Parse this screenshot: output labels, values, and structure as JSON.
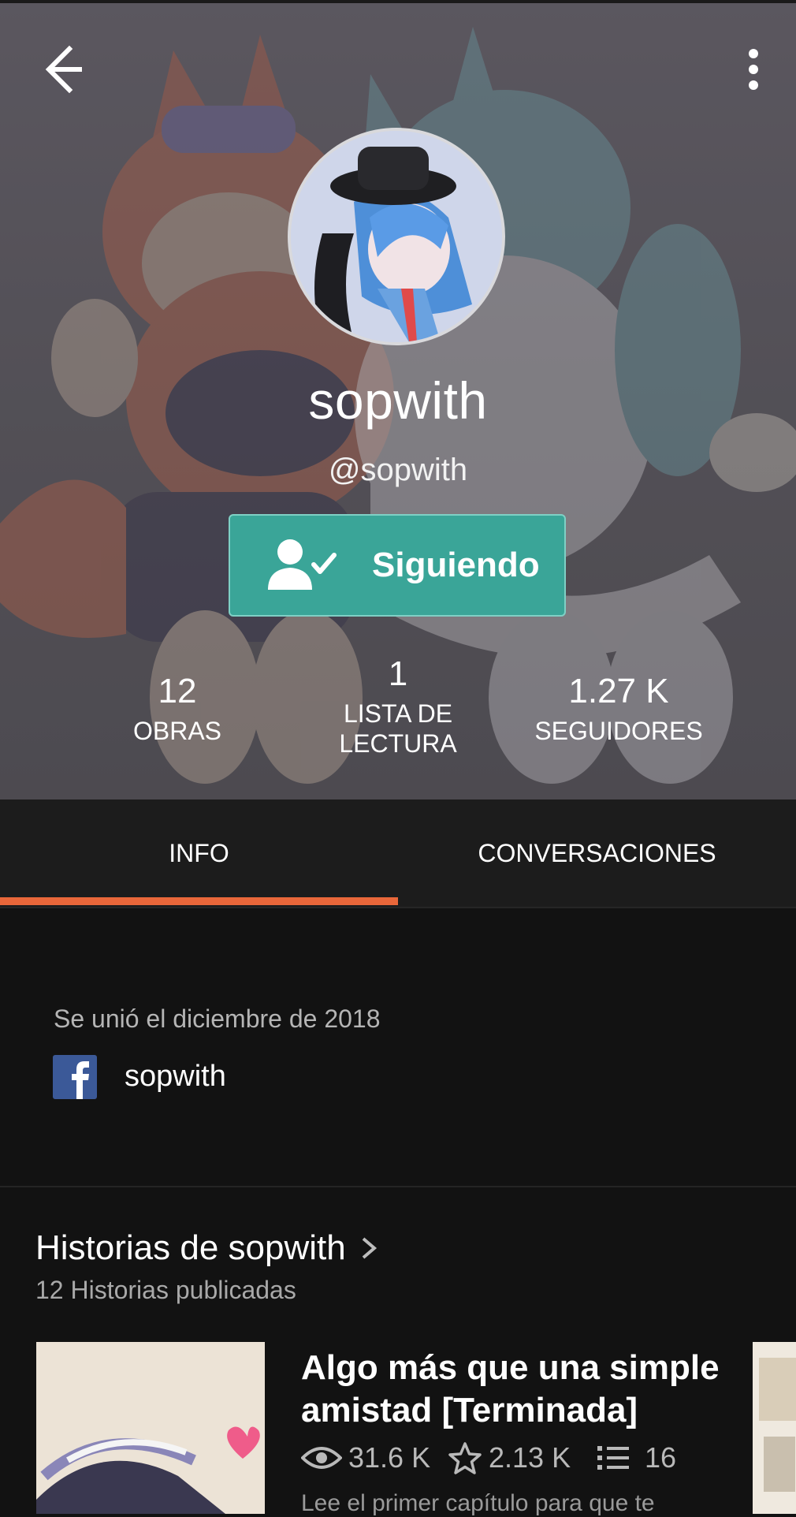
{
  "profile": {
    "display_name": "sopwith",
    "username": "@sopwith",
    "follow_label": "Siguiendo"
  },
  "stats": [
    {
      "value": "12",
      "label": "OBRAS"
    },
    {
      "value": "1",
      "label_line1": "LISTA DE",
      "label_line2": "LECTURA"
    },
    {
      "value": "1.27 K",
      "label": "SEGUIDORES"
    }
  ],
  "tabs": [
    {
      "label": "INFO",
      "active": true
    },
    {
      "label": "CONVERSACIONES",
      "active": false
    }
  ],
  "info": {
    "joined": "Se unió el diciembre de 2018",
    "facebook_name": "sopwith"
  },
  "stories": {
    "title": "Historias de sopwith",
    "subtitle": "12 Historias publicadas",
    "items": [
      {
        "title": "Algo más que una simple amistad [Terminada]",
        "reads": "31.6 K",
        "votes": "2.13 K",
        "parts": "16",
        "description": "Lee el primer capítulo para que te"
      }
    ]
  },
  "icons": {
    "back": "arrow-left-icon",
    "more": "more-vertical-icon",
    "follow": "person-check-icon",
    "facebook": "facebook-icon",
    "chevron": "chevron-right-icon",
    "reads": "eye-icon",
    "votes": "star-icon",
    "parts": "list-icon"
  },
  "colors": {
    "follow_button": "#3aa598",
    "tab_indicator": "#e9673a",
    "facebook": "#3b5998",
    "background": "#121212"
  }
}
